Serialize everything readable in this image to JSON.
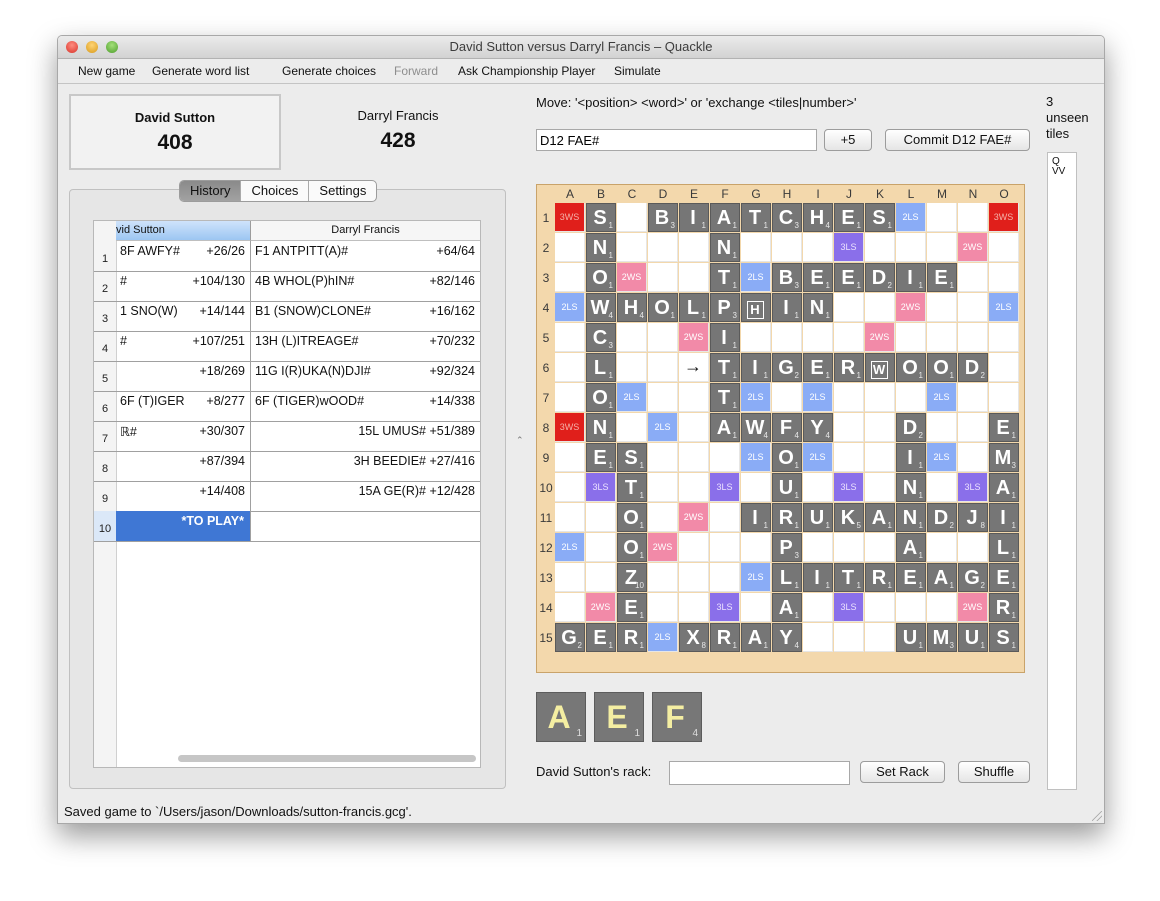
{
  "window": {
    "title": "David Sutton versus Darryl Francis – Quackle"
  },
  "toolbar": {
    "new_game": "New game",
    "generate_word_list": "Generate word list",
    "generate_choices": "Generate choices",
    "forward": "Forward",
    "ask_champion": "Ask Championship Player",
    "simulate": "Simulate"
  },
  "players": [
    {
      "name": "David Sutton",
      "score": "408"
    },
    {
      "name": "Darryl Francis",
      "score": "428"
    }
  ],
  "tabs": [
    "History",
    "Choices",
    "Settings"
  ],
  "history": {
    "columns": [
      "vid Sutton",
      "Darryl Francis"
    ],
    "rows": [
      {
        "num": "1",
        "p1_move": "8F AWFY#",
        "p1_score": "+26/26",
        "p2_move": "F1 ANTPITT(A)#",
        "p2_score": "+64/64"
      },
      {
        "num": "2",
        "p1_move": "#",
        "p1_score": "+104/130",
        "p2_move": "4B WHOL(P)hIN#",
        "p2_score": "+82/146"
      },
      {
        "num": "3",
        "p1_move": "1 SNO(W)",
        "p1_score": "+14/144",
        "p2_move": "B1 (SNOW)CLONE#",
        "p2_score": "+16/162"
      },
      {
        "num": "4",
        "p1_move": "#",
        "p1_score": "+107/251",
        "p2_move": "13H (L)ITREAGE#",
        "p2_score": "+70/232"
      },
      {
        "num": "5",
        "p1_move": "",
        "p1_score": "+18/269",
        "p2_move": "11G I(R)UKA(N)DJI#",
        "p2_score": "+92/324"
      },
      {
        "num": "6",
        "p1_move": "6F (T)IGER",
        "p1_score": "+8/277",
        "p2_move": "6F (TIGER)wOOD#",
        "p2_score": "+14/338"
      },
      {
        "num": "7",
        "p1_move": "ℝ#",
        "p1_score": "+30/307",
        "p2_move": "15L UMUS#",
        "p2_score": "+51/389"
      },
      {
        "num": "8",
        "p1_move": "",
        "p1_score": "+87/394",
        "p2_move": "3H BEEDIE#",
        "p2_score": "+27/416"
      },
      {
        "num": "9",
        "p1_move": "",
        "p1_score": "+14/408",
        "p2_move": "15A GE(R)#",
        "p2_score": "+12/428"
      },
      {
        "num": "10",
        "p1_move": "*TO PLAY*",
        "p1_score": "",
        "p2_move": "",
        "p2_score": ""
      }
    ]
  },
  "move": {
    "label": "Move: '<position> <word>' or 'exchange <tiles|number>'",
    "input_value": "D12 FAE#",
    "score_button": "+5",
    "commit_button": "Commit D12 FAE#"
  },
  "board": {
    "columns": [
      "A",
      "B",
      "C",
      "D",
      "E",
      "F",
      "G",
      "H",
      "I",
      "J",
      "K",
      "L",
      "M",
      "N",
      "O"
    ],
    "rows": [
      "1",
      "2",
      "3",
      "4",
      "5",
      "6",
      "7",
      "8",
      "9",
      "10",
      "11",
      "12",
      "13",
      "14",
      "15"
    ],
    "premium_labels": {
      "TWS": "3WS",
      "DWS": "2WS",
      "TLS": "3LS",
      "DLS": "2LS"
    },
    "premiums": [
      "T..D...T...D..T",
      ".W...L...L...W.",
      "..W...D.D...W..",
      "D..W...D...W..D",
      "....W.....W....",
      ".L...L...L...L.",
      "..D...D.D...D..",
      "T..D...W...D..T",
      "..D...D.D...D..",
      ".L...L...L...L.",
      "....W.....W....",
      "D..W...D...W..D",
      "..W...D.D...W..",
      ".W...L...L...W.",
      "T..D...T...D..T"
    ],
    "tiles": [
      [
        0,
        1,
        "S",
        "1"
      ],
      [
        0,
        3,
        "B",
        "3"
      ],
      [
        0,
        4,
        "I",
        "1"
      ],
      [
        0,
        5,
        "A",
        "1"
      ],
      [
        0,
        6,
        "T",
        "1"
      ],
      [
        0,
        7,
        "C",
        "3"
      ],
      [
        0,
        8,
        "H",
        "4"
      ],
      [
        0,
        9,
        "E",
        "1"
      ],
      [
        0,
        10,
        "S",
        "1"
      ],
      [
        1,
        1,
        "N",
        "1"
      ],
      [
        1,
        5,
        "N",
        "1"
      ],
      [
        2,
        1,
        "O",
        "1"
      ],
      [
        2,
        5,
        "T",
        "1"
      ],
      [
        2,
        7,
        "B",
        "3"
      ],
      [
        2,
        8,
        "E",
        "1"
      ],
      [
        2,
        9,
        "E",
        "1"
      ],
      [
        2,
        10,
        "D",
        "2"
      ],
      [
        2,
        11,
        "I",
        "1"
      ],
      [
        2,
        12,
        "E",
        "1"
      ],
      [
        3,
        1,
        "W",
        "4"
      ],
      [
        3,
        2,
        "H",
        "4"
      ],
      [
        3,
        3,
        "O",
        "1"
      ],
      [
        3,
        4,
        "L",
        "1"
      ],
      [
        3,
        5,
        "P",
        "3"
      ],
      [
        3,
        6,
        "H",
        "",
        true
      ],
      [
        3,
        7,
        "I",
        "1"
      ],
      [
        3,
        8,
        "N",
        "1"
      ],
      [
        4,
        1,
        "C",
        "3"
      ],
      [
        4,
        5,
        "I",
        "1"
      ],
      [
        5,
        1,
        "L",
        "1"
      ],
      [
        5,
        5,
        "T",
        "1"
      ],
      [
        5,
        6,
        "I",
        "1"
      ],
      [
        5,
        7,
        "G",
        "2"
      ],
      [
        5,
        8,
        "E",
        "1"
      ],
      [
        5,
        9,
        "R",
        "1"
      ],
      [
        5,
        10,
        "W",
        "",
        true
      ],
      [
        5,
        11,
        "O",
        "1"
      ],
      [
        5,
        12,
        "O",
        "1"
      ],
      [
        5,
        13,
        "D",
        "2"
      ],
      [
        6,
        1,
        "O",
        "1"
      ],
      [
        6,
        5,
        "T",
        "1"
      ],
      [
        7,
        1,
        "N",
        "1"
      ],
      [
        7,
        5,
        "A",
        "1"
      ],
      [
        7,
        6,
        "W",
        "4"
      ],
      [
        7,
        7,
        "F",
        "4"
      ],
      [
        7,
        8,
        "Y",
        "4"
      ],
      [
        7,
        11,
        "D",
        "2"
      ],
      [
        7,
        14,
        "E",
        "1"
      ],
      [
        8,
        1,
        "E",
        "1"
      ],
      [
        8,
        2,
        "S",
        "1"
      ],
      [
        8,
        7,
        "O",
        "1"
      ],
      [
        8,
        11,
        "I",
        "1"
      ],
      [
        8,
        14,
        "M",
        "3"
      ],
      [
        9,
        2,
        "T",
        "1"
      ],
      [
        9,
        7,
        "U",
        "1"
      ],
      [
        9,
        11,
        "N",
        "1"
      ],
      [
        9,
        14,
        "A",
        "1"
      ],
      [
        10,
        2,
        "O",
        "1"
      ],
      [
        10,
        6,
        "I",
        "1"
      ],
      [
        10,
        7,
        "R",
        "1"
      ],
      [
        10,
        8,
        "U",
        "1"
      ],
      [
        10,
        9,
        "K",
        "5"
      ],
      [
        10,
        10,
        "A",
        "1"
      ],
      [
        10,
        11,
        "N",
        "1"
      ],
      [
        10,
        12,
        "D",
        "2"
      ],
      [
        10,
        13,
        "J",
        "8"
      ],
      [
        10,
        14,
        "I",
        "1"
      ],
      [
        11,
        2,
        "O",
        "1"
      ],
      [
        11,
        7,
        "P",
        "3"
      ],
      [
        11,
        11,
        "A",
        "1"
      ],
      [
        11,
        14,
        "L",
        "1"
      ],
      [
        12,
        2,
        "Z",
        "10"
      ],
      [
        12,
        7,
        "L",
        "1"
      ],
      [
        12,
        8,
        "I",
        "1"
      ],
      [
        12,
        9,
        "T",
        "1"
      ],
      [
        12,
        10,
        "R",
        "1"
      ],
      [
        12,
        11,
        "E",
        "1"
      ],
      [
        12,
        12,
        "A",
        "1"
      ],
      [
        12,
        13,
        "G",
        "2"
      ],
      [
        12,
        14,
        "E",
        "1"
      ],
      [
        13,
        2,
        "E",
        "1"
      ],
      [
        13,
        7,
        "A",
        "1"
      ],
      [
        13,
        14,
        "R",
        "1"
      ],
      [
        14,
        0,
        "G",
        "2"
      ],
      [
        14,
        1,
        "E",
        "1"
      ],
      [
        14,
        2,
        "R",
        "1"
      ],
      [
        14,
        4,
        "X",
        "8"
      ],
      [
        14,
        5,
        "R",
        "1"
      ],
      [
        14,
        6,
        "A",
        "1"
      ],
      [
        14,
        7,
        "Y",
        "4"
      ],
      [
        14,
        11,
        "U",
        "1"
      ],
      [
        14,
        12,
        "M",
        "3"
      ],
      [
        14,
        13,
        "U",
        "1"
      ],
      [
        14,
        14,
        "S",
        "1"
      ]
    ],
    "arrow": {
      "row": 5,
      "col": 4,
      "glyph": "→"
    }
  },
  "rack": [
    {
      "letter": "A",
      "value": "1"
    },
    {
      "letter": "E",
      "value": "1"
    },
    {
      "letter": "F",
      "value": "4"
    }
  ],
  "rack_controls": {
    "label": "David Sutton's rack:",
    "input_value": "",
    "set_rack_button": "Set Rack",
    "shuffle_button": "Shuffle"
  },
  "unseen": {
    "title": "3 unseen tiles",
    "tiles": [
      "Q",
      "VV"
    ]
  },
  "status": "Saved game to `/Users/jason/Downloads/sutton-francis.gcg'.",
  "colors": {
    "tws": "#e01f1b",
    "dws": "#f28aa8",
    "tls": "#8a6fea",
    "dls": "#8aacf6",
    "tile": "#767676",
    "rack_letter": "#f4eea2",
    "history_selected": "#3f77d4"
  }
}
